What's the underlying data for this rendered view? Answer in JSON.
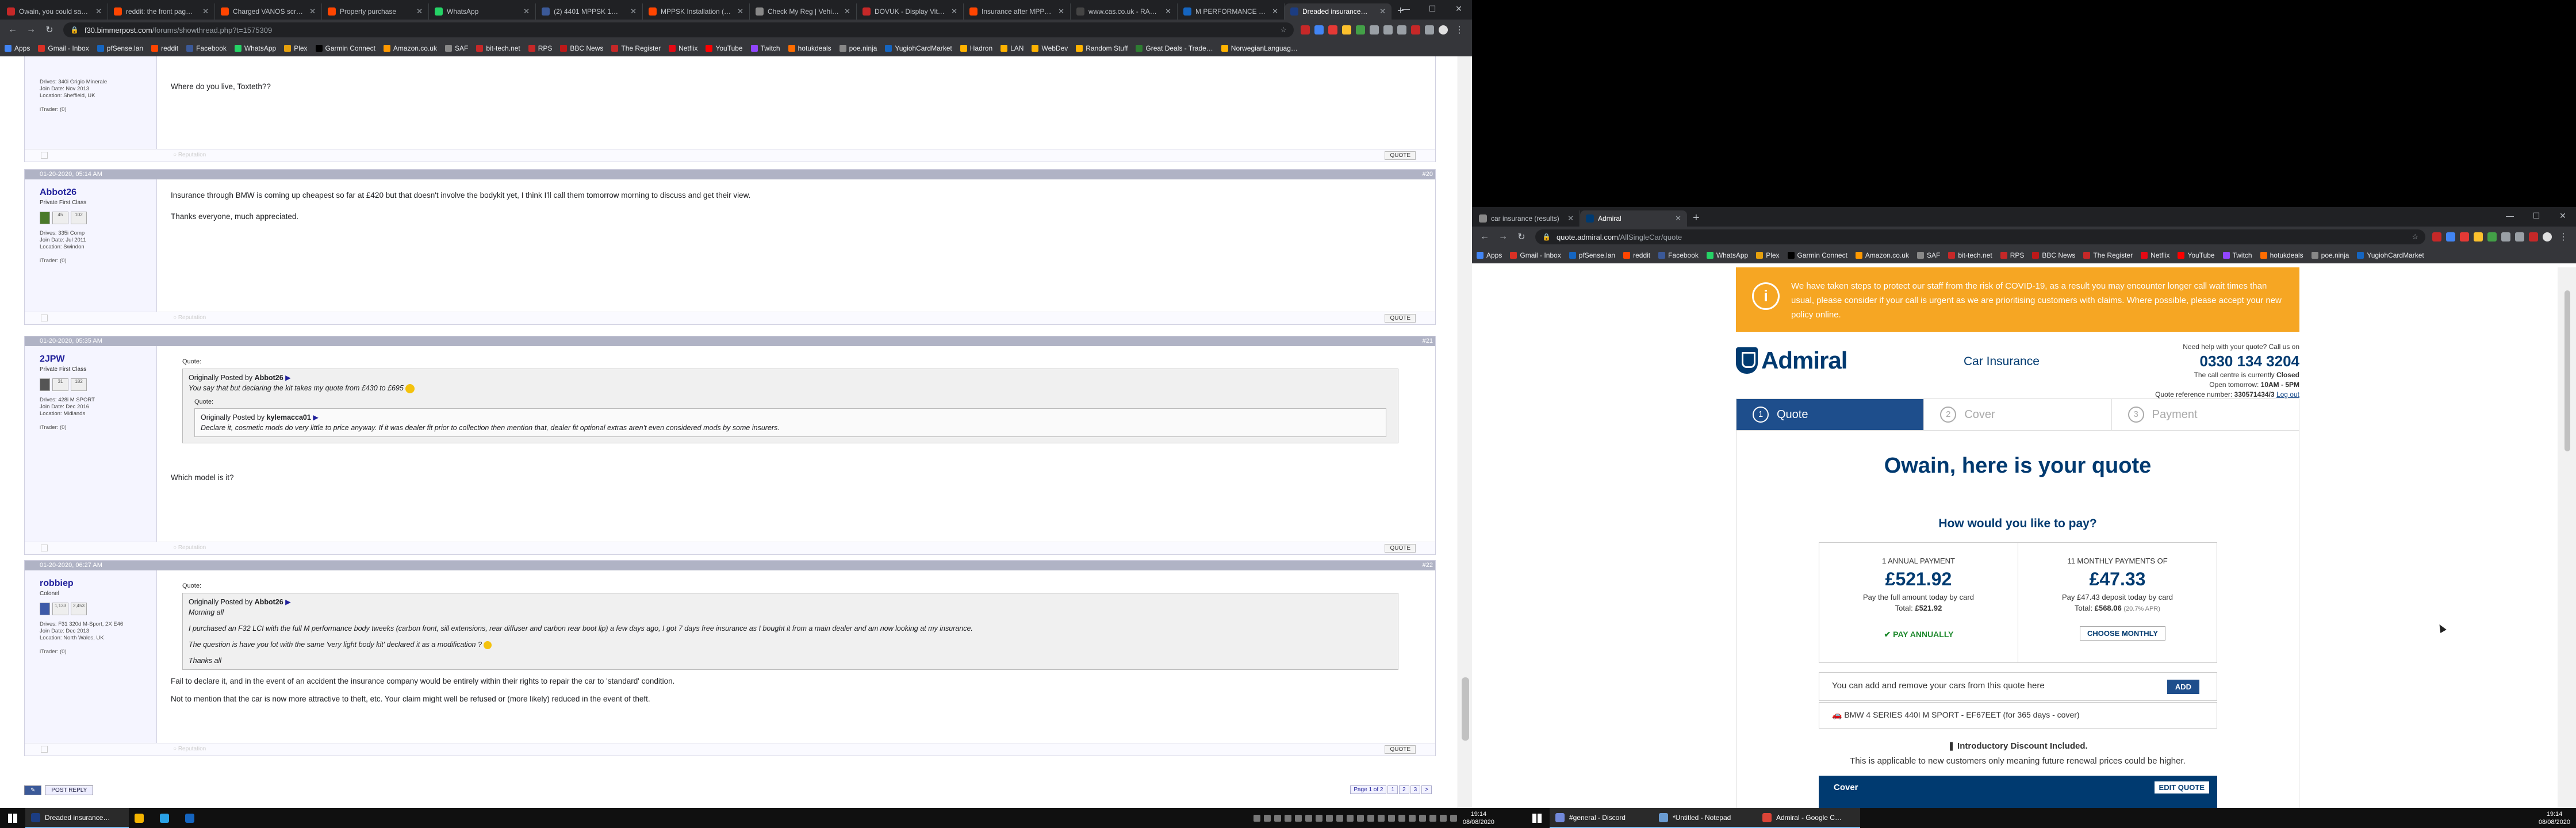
{
  "left_browser": {
    "tabs": [
      {
        "title": "Owain, you could sa…",
        "color": "#c62828"
      },
      {
        "title": "reddit: the front pag…",
        "color": "#ff4500"
      },
      {
        "title": "Charged VANOS scr…",
        "color": "#ff4500"
      },
      {
        "title": "Property purchase",
        "color": "#ff4500"
      },
      {
        "title": "WhatsApp",
        "color": "#25d366"
      },
      {
        "title": "(2) 4401 MPPSK 1…",
        "color": "#3b5998"
      },
      {
        "title": "MPPSK Installation (…",
        "color": "#ff4500"
      },
      {
        "title": "Check My Reg | Vehi…",
        "color": "#888888"
      },
      {
        "title": "DOVUK - Display Vit…",
        "color": "#c62828"
      },
      {
        "title": "Insurance after MPP…",
        "color": "#ff4500"
      },
      {
        "title": "www.cas.co.uk - RAC…",
        "color": "#444444"
      },
      {
        "title": "M PERFORMANCE P…",
        "color": "#1565c0"
      },
      {
        "title": "Dreaded insurance…",
        "color": "#1c3d82",
        "active": true
      }
    ],
    "url": "f30.bimmerpost.com/forums/showthread.php?t=1575309",
    "url_host": "f30.bimmerpost.com",
    "url_path": "/forums/showthread.php?t=1575309",
    "bookmarks": [
      {
        "label": "Apps",
        "color": "#4285f4"
      },
      {
        "label": "Gmail - Inbox",
        "color": "#d93025"
      },
      {
        "label": "pfSense.lan",
        "color": "#1565c0"
      },
      {
        "label": "reddit",
        "color": "#ff4500"
      },
      {
        "label": "Facebook",
        "color": "#3b5998"
      },
      {
        "label": "WhatsApp",
        "color": "#25d366"
      },
      {
        "label": "Plex",
        "color": "#e5a00d"
      },
      {
        "label": "Garmin Connect",
        "color": "#000000"
      },
      {
        "label": "Amazon.co.uk",
        "color": "#ff9900"
      },
      {
        "label": "SAF",
        "color": "#888888"
      },
      {
        "label": "bit-tech.net",
        "color": "#c62828"
      },
      {
        "label": "RPS",
        "color": "#c62828"
      },
      {
        "label": "BBC News",
        "color": "#bb1919"
      },
      {
        "label": "The Register",
        "color": "#c62828"
      },
      {
        "label": "Netflix",
        "color": "#e50914"
      },
      {
        "label": "YouTube",
        "color": "#ff0000"
      },
      {
        "label": "Twitch",
        "color": "#9146ff"
      },
      {
        "label": "hotukdeals",
        "color": "#ff6d00"
      },
      {
        "label": "poe.ninja",
        "color": "#888888"
      },
      {
        "label": "YugiohCardMarket",
        "color": "#1565c0"
      },
      {
        "label": "Hadron",
        "color": "#ffb300"
      },
      {
        "label": "LAN",
        "color": "#ffb300"
      },
      {
        "label": "WebDev",
        "color": "#ffb300"
      },
      {
        "label": "Random Stuff",
        "color": "#ffb300"
      },
      {
        "label": "Great Deals - Trade…",
        "color": "#2e7d32"
      },
      {
        "label": "NorwegianLanguag…",
        "color": "#ffb300"
      }
    ],
    "posts": [
      {
        "user_info": [
          "Drives: 340i Grigio Minerale",
          "Join Date: Nov 2013",
          "Location: Sheffield, UK"
        ],
        "itrader": "iTrader: (0)",
        "body": [
          "Where do you live, Toxteth??"
        ],
        "quote_button": "QUOTE"
      },
      {
        "date": "01-20-2020, 05:14 AM",
        "num": "#20",
        "username": "Abbot26",
        "title": "Private First Class",
        "stats": [
          "45",
          "102"
        ],
        "user_info": [
          "Drives: 335i Comp",
          "Join Date: Jul 2011",
          "Location: Swindon"
        ],
        "itrader": "iTrader: (0)",
        "body": [
          "Insurance through BMW is coming up cheapest so far at £420 but that doesn't involve the bodykit yet, I think I'll call them tomorrow morning to discuss and get their view.",
          "Thanks everyone, much appreciated."
        ],
        "quote_button": "QUOTE"
      },
      {
        "date": "01-20-2020, 05:35 AM",
        "num": "#21",
        "username": "2JPW",
        "title": "Private First Class",
        "stats": [
          "31",
          "182"
        ],
        "user_info": [
          "Drives: 428i M SPORT",
          "Join Date: Dec 2016",
          "Location: Midlands"
        ],
        "itrader": "iTrader: (0)",
        "quote_label": "Quote:",
        "quote_by": "Originally Posted by",
        "quote_author": "Abbot26",
        "quote_text": "You say that but declaring the kit takes my quote from £430 to £695",
        "nested_label": "Quote:",
        "nested_by": "Originally Posted by",
        "nested_author": "kylemacca01",
        "nested_text": "Declare it, cosmetic mods do very little to price anyway. If it was dealer fit prior to collection then mention that, dealer fit optional extras aren't even considered mods by some insurers.",
        "body": [
          "Which model is it?"
        ],
        "quote_button": "QUOTE"
      },
      {
        "date": "01-20-2020, 06:27 AM",
        "num": "#22",
        "username": "robbiep",
        "title": "Colonel",
        "stats": [
          "1,133",
          "2,453"
        ],
        "user_info": [
          "Drives: F31 320d M-Sport, 2X E46",
          "Join Date: Dec 2013",
          "Location: North Wales, UK"
        ],
        "itrader": "iTrader: (0)",
        "quote_label": "Quote:",
        "quote_by": "Originally Posted by",
        "quote_author": "Abbot26",
        "quote_lines": [
          "Morning all",
          "I purchased an F32 LCI with the full M performance body tweeks (carbon front, sill extensions, rear diffuser and carbon rear boot lip) a few days ago, I got 7 days free insurance as I bought it from a main dealer and am now looking at my insurance.",
          "The question is have you lot with the same 'very light body kit' declared it as a modification ?",
          "Thanks all"
        ],
        "body": [
          "Fail to declare it, and in the event of an accident the insurance company would be entirely within their rights to repair the car to 'standard' condition.",
          "Not to mention that the car is now more attractive to theft, etc. Your claim might well be refused or (more likely) reduced in the event of theft."
        ],
        "quote_button": "QUOTE"
      }
    ],
    "pager": [
      "Page 1 of 2",
      "1",
      "2",
      "3",
      ">"
    ],
    "post_reply": "POST REPLY"
  },
  "right_browser": {
    "tabs": [
      {
        "title": "car insurance (results)",
        "color": "#888888"
      },
      {
        "title": "Admiral",
        "color": "#003a70",
        "active": true
      }
    ],
    "url": "quote.admiral.com/AllSingleCar/quote",
    "url_host": "quote.admiral.com",
    "url_path": "/AllSingleCar/quote",
    "bookmarks": [
      {
        "label": "Apps",
        "color": "#4285f4"
      },
      {
        "label": "Gmail - Inbox",
        "color": "#d93025"
      },
      {
        "label": "pfSense.lan",
        "color": "#1565c0"
      },
      {
        "label": "reddit",
        "color": "#ff4500"
      },
      {
        "label": "Facebook",
        "color": "#3b5998"
      },
      {
        "label": "WhatsApp",
        "color": "#25d366"
      },
      {
        "label": "Plex",
        "color": "#e5a00d"
      },
      {
        "label": "Garmin Connect",
        "color": "#000000"
      },
      {
        "label": "Amazon.co.uk",
        "color": "#ff9900"
      },
      {
        "label": "SAF",
        "color": "#888888"
      },
      {
        "label": "bit-tech.net",
        "color": "#c62828"
      },
      {
        "label": "RPS",
        "color": "#c62828"
      },
      {
        "label": "BBC News",
        "color": "#bb1919"
      },
      {
        "label": "The Register",
        "color": "#c62828"
      },
      {
        "label": "Netflix",
        "color": "#e50914"
      },
      {
        "label": "YouTube",
        "color": "#ff0000"
      },
      {
        "label": "Twitch",
        "color": "#9146ff"
      },
      {
        "label": "hotukdeals",
        "color": "#ff6d00"
      },
      {
        "label": "poe.ninja",
        "color": "#888888"
      },
      {
        "label": "YugiohCardMarket",
        "color": "#1565c0"
      }
    ],
    "covid_notice": "We have taken steps to protect our staff from the risk of COVID-19, as a result you may encounter longer call wait times than usual, please consider if your call is urgent as we are prioritising customers with claims. Where possible, please accept your new policy online.",
    "brand": "Admiral",
    "product": "Car Insurance",
    "help_text": "Need help with your quote? Call us on",
    "phone": "0330 134 3204",
    "call_status_label": "The call centre is currently",
    "call_status": "Closed",
    "open_tomorrow_label": "Open tomorrow:",
    "open_tomorrow": "10AM - 5PM",
    "ref_label": "Quote reference number:",
    "ref": "330571434/3",
    "ref_link": "Log out",
    "steps": [
      {
        "n": "1",
        "label": "Quote",
        "active": true
      },
      {
        "n": "2",
        "label": "Cover"
      },
      {
        "n": "3",
        "label": "Payment"
      }
    ],
    "heading": "Owain, here is your quote",
    "subheading": "How would you like to pay?",
    "annual": {
      "label": "1 ANNUAL PAYMENT",
      "amount": "£521.92",
      "desc": "Pay the full amount today by card",
      "total_label": "Total:",
      "total": "£521.92",
      "button": "PAY ANNUALLY"
    },
    "monthly": {
      "label": "11 MONTHLY PAYMENTS OF",
      "amount": "£47.33",
      "desc": "Pay £47.43 deposit today by card",
      "total_label": "Total:",
      "total": "£568.06",
      "apr": "(20.7% APR)",
      "button": "CHOOSE MONTHLY"
    },
    "add_cars": "You can add and remove your cars from this quote here",
    "add_button": "ADD",
    "car": "BMW 4 SERIES 440I M SPORT - EF67EET (for 365 days - cover)",
    "intro_title": "Introductory Discount Included.",
    "intro_text": "This is applicable to new customers only meaning future renewal prices could be higher.",
    "cover_label": "Cover",
    "edit_quote": "EDIT QUOTE"
  },
  "taskbar": {
    "left_items": [
      {
        "label": "Dreaded insurance…",
        "color": "#1c3d82",
        "running": true
      },
      {
        "label": "",
        "color": "#f4b400"
      },
      {
        "label": "",
        "color": "#2aa1e6"
      },
      {
        "label": "",
        "color": "#1565c0"
      }
    ],
    "right_items": [
      {
        "label": "#general - Discord",
        "color": "#7289da",
        "running": true
      },
      {
        "label": "*Untitled - Notepad",
        "color": "#6a9bd1",
        "running": true
      },
      {
        "label": "Admiral - Google C…",
        "color": "#db4437",
        "running": true
      }
    ],
    "left_time": "19:14",
    "left_date": "08/08/2020",
    "right_time": "19:14",
    "right_date": "08/08/2020"
  }
}
